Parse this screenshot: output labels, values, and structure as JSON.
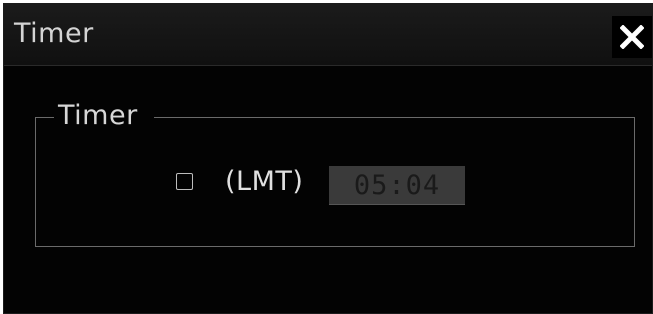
{
  "window": {
    "title": "Timer"
  },
  "icons": {
    "close": "close-icon"
  },
  "timer_group": {
    "legend": "Timer",
    "checkbox_checked": false,
    "lmt_label": "(LMT)",
    "time_value": "05:04"
  },
  "colors": {
    "background": "#030303",
    "text": "#d6d6d6",
    "field_bg": "#3a3a3a",
    "field_text": "#1a1a1a"
  }
}
